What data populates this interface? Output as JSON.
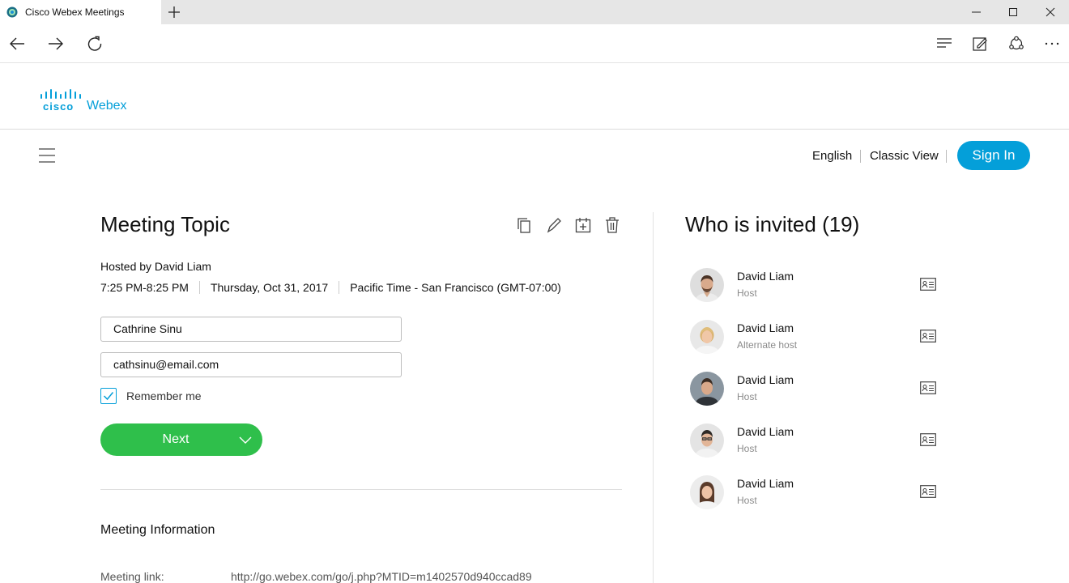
{
  "browser": {
    "tab_title": "Cisco Webex Meetings",
    "new_tab_icon": "plus-icon",
    "window_controls": [
      "minimize-icon",
      "maximize-icon",
      "close-icon"
    ],
    "nav_icons": [
      "back-arrow-icon",
      "forward-arrow-icon",
      "refresh-icon"
    ],
    "toolbar_icons": [
      "hub-icon",
      "web-note-icon",
      "share-icon",
      "more-icon"
    ]
  },
  "header": {
    "logo_cisco": "cisco",
    "logo_webex": "Webex",
    "menu_icon": "hamburger-menu-icon",
    "language": "English",
    "classic_view": "Classic View",
    "sign_in": "Sign In"
  },
  "meeting": {
    "topic": "Meeting Topic",
    "actions": [
      "copy-icon",
      "edit-icon",
      "add-calendar-icon",
      "delete-icon"
    ],
    "hosted_by": "Hosted by David Liam",
    "time": "7:25 PM-8:25 PM",
    "date": "Thursday, Oct 31, 2017",
    "timezone": "Pacific Time - San Francisco (GMT-07:00)",
    "name_value": "Cathrine Sinu",
    "email_value": "cathsinu@email.com",
    "remember_label": "Remember me",
    "remember_checked": true,
    "next_label": "Next",
    "info_heading": "Meeting Information",
    "link_label": "Meeting link:",
    "link_value": "http://go.webex.com/go/j.php?MTID=m1402570d940ccad89"
  },
  "invited": {
    "heading": "Who is invited (19)",
    "people": [
      {
        "name": "David Liam",
        "role": "Host"
      },
      {
        "name": "David Liam",
        "role": "Alternate host"
      },
      {
        "name": "David Liam",
        "role": "Host"
      },
      {
        "name": "David Liam",
        "role": "Host"
      },
      {
        "name": "David Liam",
        "role": "Host"
      }
    ]
  },
  "colors": {
    "accent": "#049fd9",
    "next_button": "#2fbf4b"
  }
}
